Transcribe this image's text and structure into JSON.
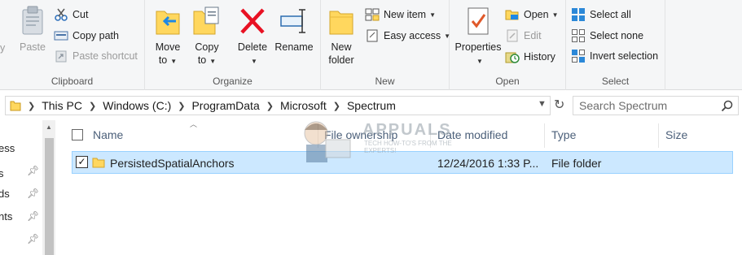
{
  "ribbon": {
    "clipboard": {
      "label": "Clipboard",
      "paste_label": "Paste",
      "pin_fragment": "y",
      "cut_label": "Cut",
      "copy_path_label": "Copy path",
      "paste_shortcut_label": "Paste shortcut"
    },
    "organize": {
      "label": "Organize",
      "move_to_line1": "Move",
      "move_to_line2": "to",
      "copy_to_line1": "Copy",
      "copy_to_line2": "to",
      "delete_label": "Delete",
      "rename_label": "Rename"
    },
    "new": {
      "label": "New",
      "new_folder_line1": "New",
      "new_folder_line2": "folder",
      "new_item_label": "New item",
      "easy_access_label": "Easy access"
    },
    "open": {
      "label": "Open",
      "properties_label": "Properties",
      "open_label": "Open",
      "edit_label": "Edit",
      "history_label": "History"
    },
    "select": {
      "label": "Select",
      "select_all_label": "Select all",
      "select_none_label": "Select none",
      "invert_selection_label": "Invert selection"
    }
  },
  "address": {
    "crumbs": [
      "This PC",
      "Windows (C:)",
      "ProgramData",
      "Microsoft",
      "Spectrum"
    ],
    "search_placeholder": "Search Spectrum"
  },
  "navpane": {
    "items": [
      "ess",
      "s",
      "ds",
      "nts"
    ]
  },
  "filelist": {
    "columns": [
      "Name",
      "File ownership",
      "Date modified",
      "Type",
      "Size"
    ],
    "rows": [
      {
        "name": "PersistedSpatialAnchors",
        "ownership": "",
        "date_modified": "12/24/2016 1:33 P...",
        "type": "File folder",
        "size": "",
        "checked": true
      }
    ]
  },
  "watermark": {
    "brand": "APPUALS",
    "tagline": "TECH HOW-TO'S FROM THE EXPERTS!"
  },
  "colors": {
    "selection_bg": "#cce8ff",
    "selection_border": "#99d1ff",
    "header_text": "#4c607a",
    "delete_red": "#e81123",
    "folder_yellow": "#ffd75e",
    "accent_blue": "#1e88e5"
  }
}
